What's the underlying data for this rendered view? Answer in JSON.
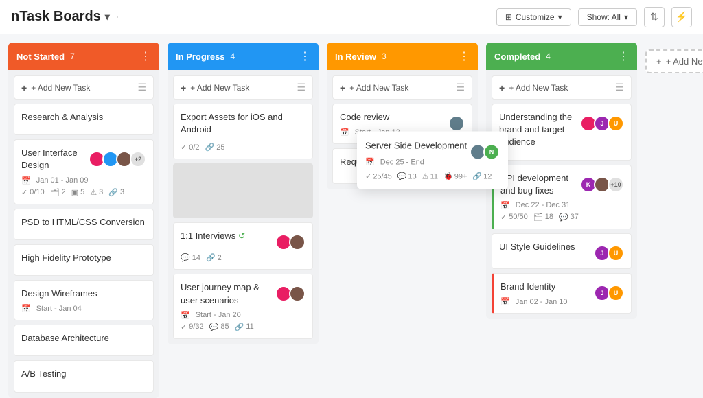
{
  "app": {
    "title": "nTask Boards",
    "title_arrow": "▾",
    "sep": "·"
  },
  "header": {
    "customize_label": "Customize",
    "show_label": "Show: All",
    "sort_icon": "sort",
    "filter_icon": "filter"
  },
  "columns": [
    {
      "id": "not-started",
      "title": "Not Started",
      "count": "7",
      "color_class": "col-not-started",
      "add_task_label": "+ Add New Task",
      "cards": [
        {
          "id": "c1",
          "title": "Research & Analysis",
          "meta": [],
          "stats": [],
          "avatars": []
        },
        {
          "id": "c2",
          "title": "User Interface Design",
          "meta": [
            {
              "type": "date",
              "val": "Jan 01 - Jan 09"
            }
          ],
          "avatars": [
            {
              "color": "#e91e63",
              "letter": ""
            },
            {
              "color": "#2196f3",
              "letter": ""
            },
            {
              "color": "#795548",
              "letter": ""
            }
          ],
          "extra_count": "+2",
          "stats": [
            {
              "icon": "✓",
              "val": "0/10"
            },
            {
              "icon": "🗂",
              "val": "2"
            },
            {
              "icon": "▣",
              "val": "5"
            },
            {
              "icon": "⚠",
              "val": "3"
            },
            {
              "icon": "🔗",
              "val": "3"
            }
          ]
        },
        {
          "id": "c3",
          "title": "PSD to HTML/CSS Conversion",
          "meta": [],
          "stats": [],
          "avatars": []
        },
        {
          "id": "c4",
          "title": "High Fidelity Prototype",
          "meta": [],
          "stats": [],
          "avatars": []
        },
        {
          "id": "c5",
          "title": "Design Wireframes",
          "meta": [
            {
              "type": "date",
              "val": "Start - Jan 04"
            }
          ],
          "stats": [],
          "avatars": []
        },
        {
          "id": "c6",
          "title": "Database Architecture",
          "meta": [],
          "stats": [],
          "avatars": []
        },
        {
          "id": "c7",
          "title": "A/B Testing",
          "meta": [],
          "stats": [],
          "avatars": []
        }
      ]
    },
    {
      "id": "in-progress",
      "title": "In Progress",
      "count": "4",
      "color_class": "col-in-progress",
      "add_task_label": "+ Add New Task",
      "cards": [
        {
          "id": "c8",
          "title": "Export Assets for iOS and Android",
          "meta": [],
          "stats": [
            {
              "icon": "✓",
              "val": "0/2"
            },
            {
              "icon": "🔗",
              "val": "25"
            }
          ],
          "avatars": []
        },
        {
          "id": "c9_placeholder",
          "title": "",
          "placeholder": true,
          "meta": [],
          "stats": [],
          "avatars": []
        },
        {
          "id": "c10",
          "title": "1:1 Interviews",
          "meta": [],
          "stats": [
            {
              "icon": "💬",
              "val": "14"
            },
            {
              "icon": "🔗",
              "val": "2"
            }
          ],
          "avatars": [
            {
              "color": "#e91e63",
              "letter": ""
            },
            {
              "color": "#795548",
              "letter": ""
            }
          ],
          "has_repeat": true
        },
        {
          "id": "c11",
          "title": "User journey map & user scenarios",
          "meta": [
            {
              "type": "date",
              "val": "Start - Jan 20"
            }
          ],
          "stats": [
            {
              "icon": "✓",
              "val": "9/32"
            },
            {
              "icon": "💬",
              "val": "85"
            },
            {
              "icon": "🔗",
              "val": "11"
            }
          ],
          "avatars": [
            {
              "color": "#e91e63",
              "letter": ""
            },
            {
              "color": "#795548",
              "letter": ""
            }
          ]
        }
      ]
    },
    {
      "id": "in-review",
      "title": "In Review",
      "count": "3",
      "color_class": "col-in-review",
      "add_task_label": "+ Add New Task",
      "cards": [
        {
          "id": "c12",
          "title": "Code review",
          "meta": [
            {
              "type": "date",
              "val": "Start - Jan 13"
            }
          ],
          "stats": [],
          "avatars": [
            {
              "color": "#607d8b",
              "letter": ""
            }
          ]
        },
        {
          "id": "c13",
          "title": "Requirement Document",
          "meta": [],
          "stats": [],
          "avatars": [
            {
              "color": "#607d8b",
              "letter": ""
            }
          ]
        }
      ],
      "popup": {
        "title": "Server Side Development",
        "date": "Dec 25 - End",
        "avatars": [
          {
            "color": "#607d8b",
            "letter": ""
          },
          {
            "color": "#4caf50",
            "letter": "N"
          }
        ],
        "stats": [
          {
            "icon": "✓",
            "val": "25/45"
          },
          {
            "icon": "💬",
            "val": "13"
          },
          {
            "icon": "⚠",
            "val": "11"
          },
          {
            "icon": "🐞",
            "val": "99+"
          },
          {
            "icon": "🔗",
            "val": "12"
          }
        ]
      }
    },
    {
      "id": "completed",
      "title": "Completed",
      "count": "4",
      "color_class": "col-completed",
      "add_task_label": "+ Add New Task",
      "cards": [
        {
          "id": "c14",
          "title": "Understanding the brand and target audience",
          "meta": [],
          "stats": [],
          "avatars": [
            {
              "color": "#e91e63",
              "letter": ""
            },
            {
              "color": "#9c27b0",
              "letter": "J"
            },
            {
              "color": "#ff9800",
              "letter": "U"
            }
          ]
        },
        {
          "id": "c15",
          "title": "API development and bug fixes",
          "meta": [
            {
              "type": "date",
              "val": "Dec 22 - Dec 31"
            }
          ],
          "stats": [
            {
              "icon": "✓",
              "val": "50/50"
            },
            {
              "icon": "🗂",
              "val": "18"
            },
            {
              "icon": "💬",
              "val": "37"
            }
          ],
          "avatars": [
            {
              "color": "#9c27b0",
              "letter": "K"
            },
            {
              "color": "#795548",
              "letter": ""
            }
          ],
          "extra_count": "+10",
          "accent": "green"
        },
        {
          "id": "c16",
          "title": "UI Style Guidelines",
          "meta": [],
          "stats": [],
          "avatars": [
            {
              "color": "#9c27b0",
              "letter": "J"
            },
            {
              "color": "#ff9800",
              "letter": "U"
            }
          ]
        },
        {
          "id": "c17",
          "title": "Brand Identity",
          "meta": [
            {
              "type": "date",
              "val": "Jan 02 - Jan 10"
            }
          ],
          "stats": [],
          "avatars": [
            {
              "color": "#9c27b0",
              "letter": "J"
            },
            {
              "color": "#ff9800",
              "letter": "U"
            }
          ],
          "accent": "red"
        }
      ]
    }
  ],
  "add_new": {
    "label": "+ Add New"
  }
}
